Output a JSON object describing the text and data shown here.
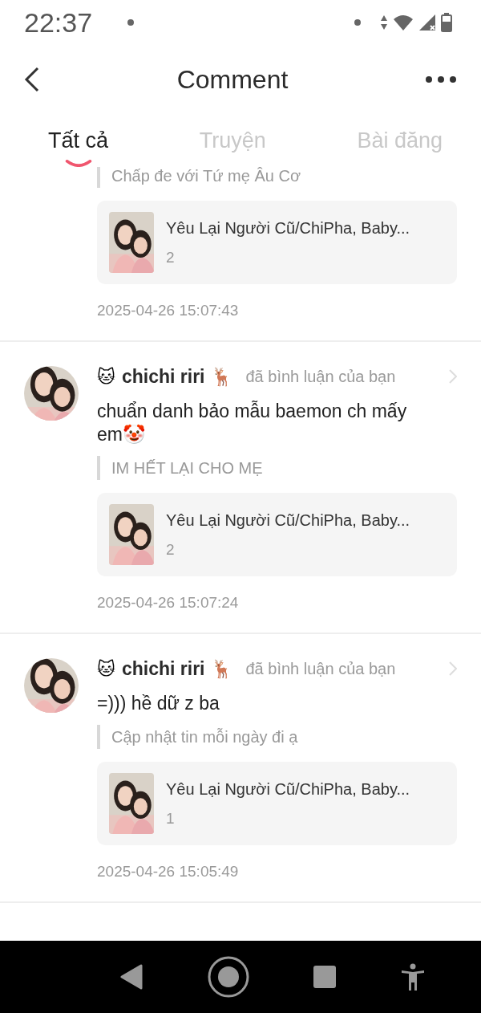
{
  "status_bar": {
    "time": "22:37"
  },
  "header": {
    "title": "Comment"
  },
  "tabs": [
    {
      "label": "Tất cả",
      "selected": true
    },
    {
      "label": "Truyện",
      "selected": false
    },
    {
      "label": "Bài đăng",
      "selected": false
    }
  ],
  "comments": [
    {
      "kind": "partial",
      "quote": "Chấp đe với Tứ mẹ Âu Cơ",
      "post": {
        "title": "Yêu Lại Người Cũ/ChiPha, Baby...",
        "count": "2"
      },
      "time": "2025-04-26 15:07:43"
    },
    {
      "kind": "full",
      "user": {
        "name_prefix": "🐱",
        "name": "chichi riri",
        "name_suffix": "🦌"
      },
      "action": "đã bình luận của bạn",
      "text": "chuẩn danh bảo mẫu baemon ch mấy em🤡",
      "quote": "IM HẾT LẠI CHO MẸ",
      "post": {
        "title": "Yêu Lại Người Cũ/ChiPha, Baby...",
        "count": "2"
      },
      "time": "2025-04-26 15:07:24"
    },
    {
      "kind": "full",
      "user": {
        "name_prefix": "🐱",
        "name": "chichi riri",
        "name_suffix": "🦌"
      },
      "action": "đã bình luận của bạn",
      "text": "=))) hề dữ z ba",
      "quote": "Cập nhật tin mỗi ngày đi ạ",
      "post": {
        "title": "Yêu Lại Người Cũ/ChiPha, Baby...",
        "count": "1"
      },
      "time": "2025-04-26 15:05:49"
    }
  ]
}
